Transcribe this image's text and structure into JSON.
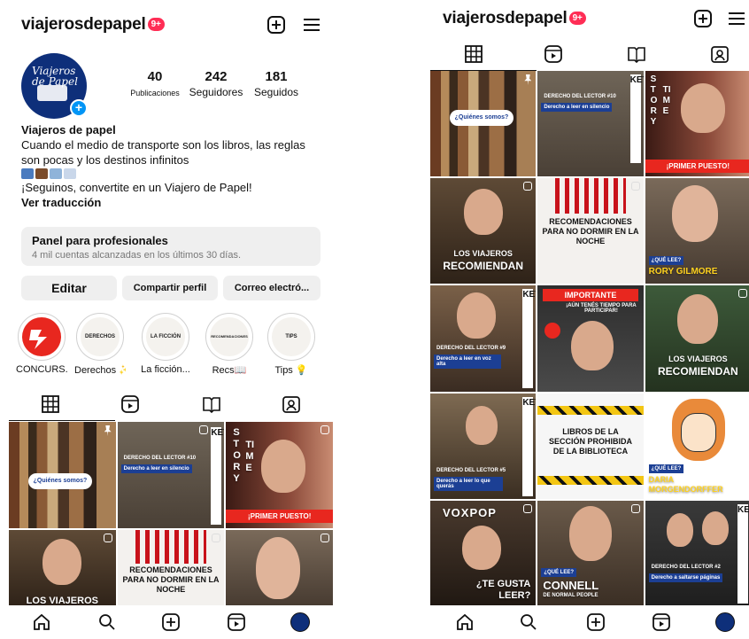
{
  "profile": {
    "username": "viajerosdepapel",
    "notif_badge": "9+",
    "avatar_text": "Viajeros de Papel",
    "stats": [
      {
        "value": "40",
        "label": "Publicaciones"
      },
      {
        "value": "242",
        "label": "Seguidores"
      },
      {
        "value": "181",
        "label": "Seguidos"
      }
    ],
    "name": "Viajeros de papel",
    "bio_line1": "Cuando el medio de transporte son los libros, las reglas son pocas y los destinos infinitos",
    "bio_line2": "¡Seguinos, convertite en un Viajero de Papel!",
    "see_translation": "Ver traducción"
  },
  "panel": {
    "title": "Panel para profesionales",
    "subtitle": "4 mil cuentas alcanzadas en los últimos 30 días."
  },
  "buttons": {
    "edit": "Editar",
    "share": "Compartir perfil",
    "email": "Correo electró..."
  },
  "highlights": [
    {
      "cover": "",
      "label": "CONCURS..."
    },
    {
      "cover": "DERECHOS",
      "label": "Derechos ✨"
    },
    {
      "cover": "LA FICCIÓN",
      "label": "La ficción..."
    },
    {
      "cover": "RECOMENDACIONES",
      "label": "Recs📖"
    },
    {
      "cover": "TIPS",
      "label": "Tips 💡"
    }
  ],
  "tiles": {
    "quienes": "¿Quiénes somos?",
    "derecho10_title": "DERECHO DEL LECTOR #10",
    "derecho10_sub": "Derecho a leer en silencio",
    "sketch": "KETCH",
    "story": "STORY",
    "time": "TIME",
    "primer": "¡PRIMER PUESTO!",
    "los_viajeros": "LOS VIAJEROS",
    "recomiendan": "RECOMIENDAN",
    "recomendaciones": "RECOMENDACIONES PARA NO DORMIR EN LA NOCHE",
    "que_lee": "¿QUÉ LEE?",
    "rory": "RORY GILMORE",
    "derecho9_title": "DERECHO DEL LECTOR #9",
    "derecho9_sub": "Derecho a leer en voz alta",
    "importante": "IMPORTANTE",
    "aun_tenes": "¡AÚN TENÉS TIEMPO PARA PARTICIPAR!",
    "derecho5_title": "DERECHO DEL LECTOR #5",
    "derecho5_sub": "Derecho a leer lo que querás",
    "libros_prohibida": "LIBROS DE LA SECCIÓN PROHIBIDA DE LA BIBLIOTECA",
    "daria": "DARIA MORGENDORFFER",
    "voxpop": "VOXPOP",
    "te_gusta": "¿TE GUSTA LEER?",
    "connell": "CONNELL",
    "normal_people": "DE NORMAL PEOPLE",
    "derecho2_title": "DERECHO DEL LECTOR #2",
    "derecho2_sub": "Derecho a saltarse páginas"
  },
  "colors": {
    "accent_blue": "#1c3f94",
    "badge_red": "#ff2d55",
    "alert_red": "#e8271f",
    "button_gray": "#efefef"
  }
}
